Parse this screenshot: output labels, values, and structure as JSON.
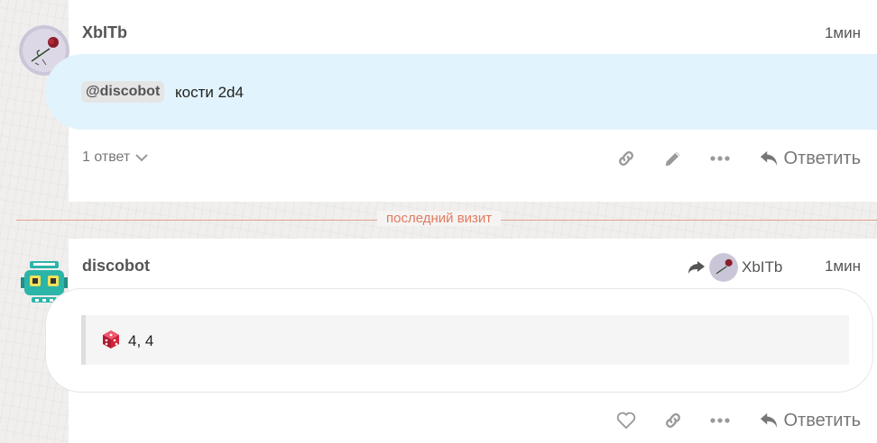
{
  "posts": [
    {
      "username": "XbITb",
      "time": "1мин",
      "mention": "@discobot",
      "text": "кости 2d4",
      "replies_label": "1 ответ",
      "reply_label": "Ответить",
      "actions": [
        "link-icon",
        "pencil-icon",
        "ellipsis-icon"
      ]
    },
    {
      "username": "discobot",
      "time": "1мин",
      "reply_to_username": "XbITb",
      "dice_result": "4, 4",
      "reply_label": "Ответить",
      "actions": [
        "heart-icon",
        "link-icon",
        "ellipsis-icon"
      ]
    }
  ],
  "last_visit_label": "последний визит",
  "colors": {
    "bubble_highlight": "#e1f3fc",
    "last_visit": "#e07a5f",
    "bot_teal": "#2bb5a8",
    "dice_red": "#d2233c"
  }
}
